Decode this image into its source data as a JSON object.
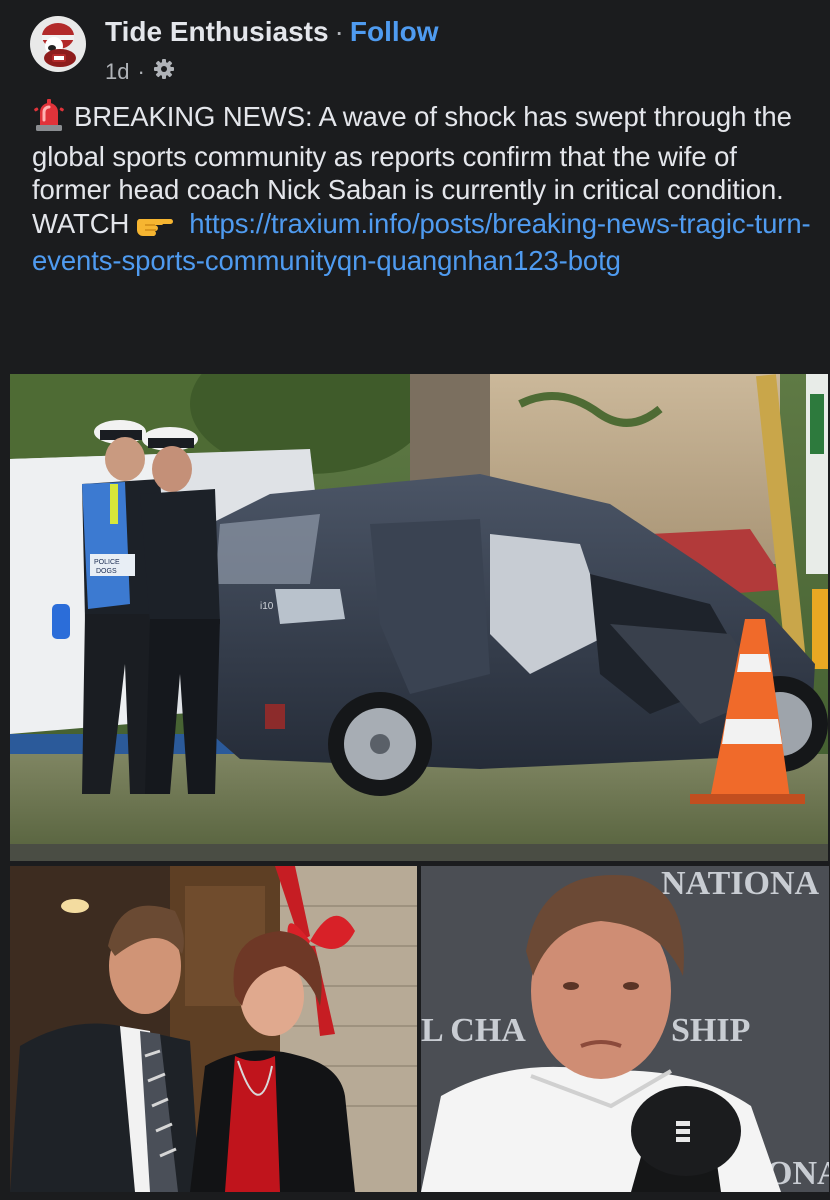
{
  "post": {
    "page_name": "Tide Enthusiasts",
    "separator": "·",
    "follow_label": "Follow",
    "time_ago": "1d",
    "meta_separator": "·",
    "audience_icon": "gear-icon",
    "text_siren_icon": "police-light-emoji",
    "text_main": "BREAKING NEWS: A wave of shock has swept through the global sports community as reports confirm that the wife of former head coach Nick Saban is currently in critical condition.",
    "watch_label": "WATCH",
    "pointing_icon": "pointing-right-emoji",
    "link_text": "https://traxium.info/posts/breaking-news-tragic-turn-events-sports-communityqn-quangnhan123-botg"
  },
  "photos": {
    "main": "crash-scene-photo",
    "left": "couple-photo",
    "right": "coach-press-photo",
    "main_scene": {
      "vest_text_1": "POLICE",
      "vest_text_2": "DOGS",
      "car_badge": "i10"
    },
    "right_scene": {
      "backdrop_text_1": "NATIONA",
      "backdrop_text_2": "L CHA",
      "backdrop_text_3": "SHIP",
      "backdrop_text_4": "ONA"
    }
  },
  "colors": {
    "background": "#1b1c1e",
    "text": "#e4e6eb",
    "secondary_text": "#b0b3b8",
    "link": "#4f9bf0"
  }
}
